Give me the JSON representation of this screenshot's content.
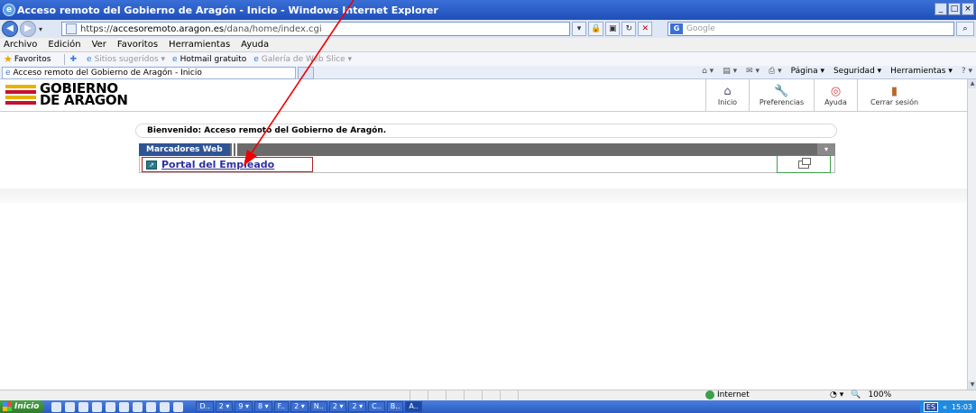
{
  "window": {
    "title": "Acceso remoto del Gobierno de Aragón - Inicio - Windows Internet Explorer",
    "buttons": [
      "_",
      "□",
      "×"
    ]
  },
  "address": {
    "proto": "https://",
    "domain": "accesoremoto.aragon.es",
    "path": "/dana/home/index.cgi",
    "search_placeholder": "Google"
  },
  "menu": [
    "Archivo",
    "Edición",
    "Ver",
    "Favoritos",
    "Herramientas",
    "Ayuda"
  ],
  "favorites": {
    "label": "Favoritos",
    "items": [
      "Sitios sugeridos ▾",
      "Hotmail gratuito",
      "Galería de Web Slice ▾"
    ]
  },
  "tab": {
    "title": "Acceso remoto del Gobierno de Aragón - Inicio"
  },
  "commands": [
    "Página ▾",
    "Seguridad ▾",
    "Herramientas ▾"
  ],
  "logo": {
    "line1": "GOBIERNO",
    "line2": "DE ARAGON"
  },
  "toolbar": {
    "home": "Inicio",
    "prefs": "Preferencias",
    "help": "Ayuda",
    "logout": "Cerrar sesión"
  },
  "welcome": "Bienvenido: Acceso remoto del Gobierno de Aragón.",
  "bookmarks": {
    "title": "Marcadores Web",
    "items": [
      {
        "label": "Portal del Empleado"
      }
    ]
  },
  "status": {
    "zone": "Internet",
    "zoom": "100%"
  },
  "taskbar": {
    "start": "Inicio",
    "tasks": [
      "D..",
      "2 ▾",
      "9 ▾",
      "8 ▾",
      "F..",
      "2 ▾",
      "N..",
      "2 ▾",
      "2 ▾",
      "C..",
      "B..",
      "A.."
    ],
    "lang": "ES",
    "clock": "15:03"
  }
}
